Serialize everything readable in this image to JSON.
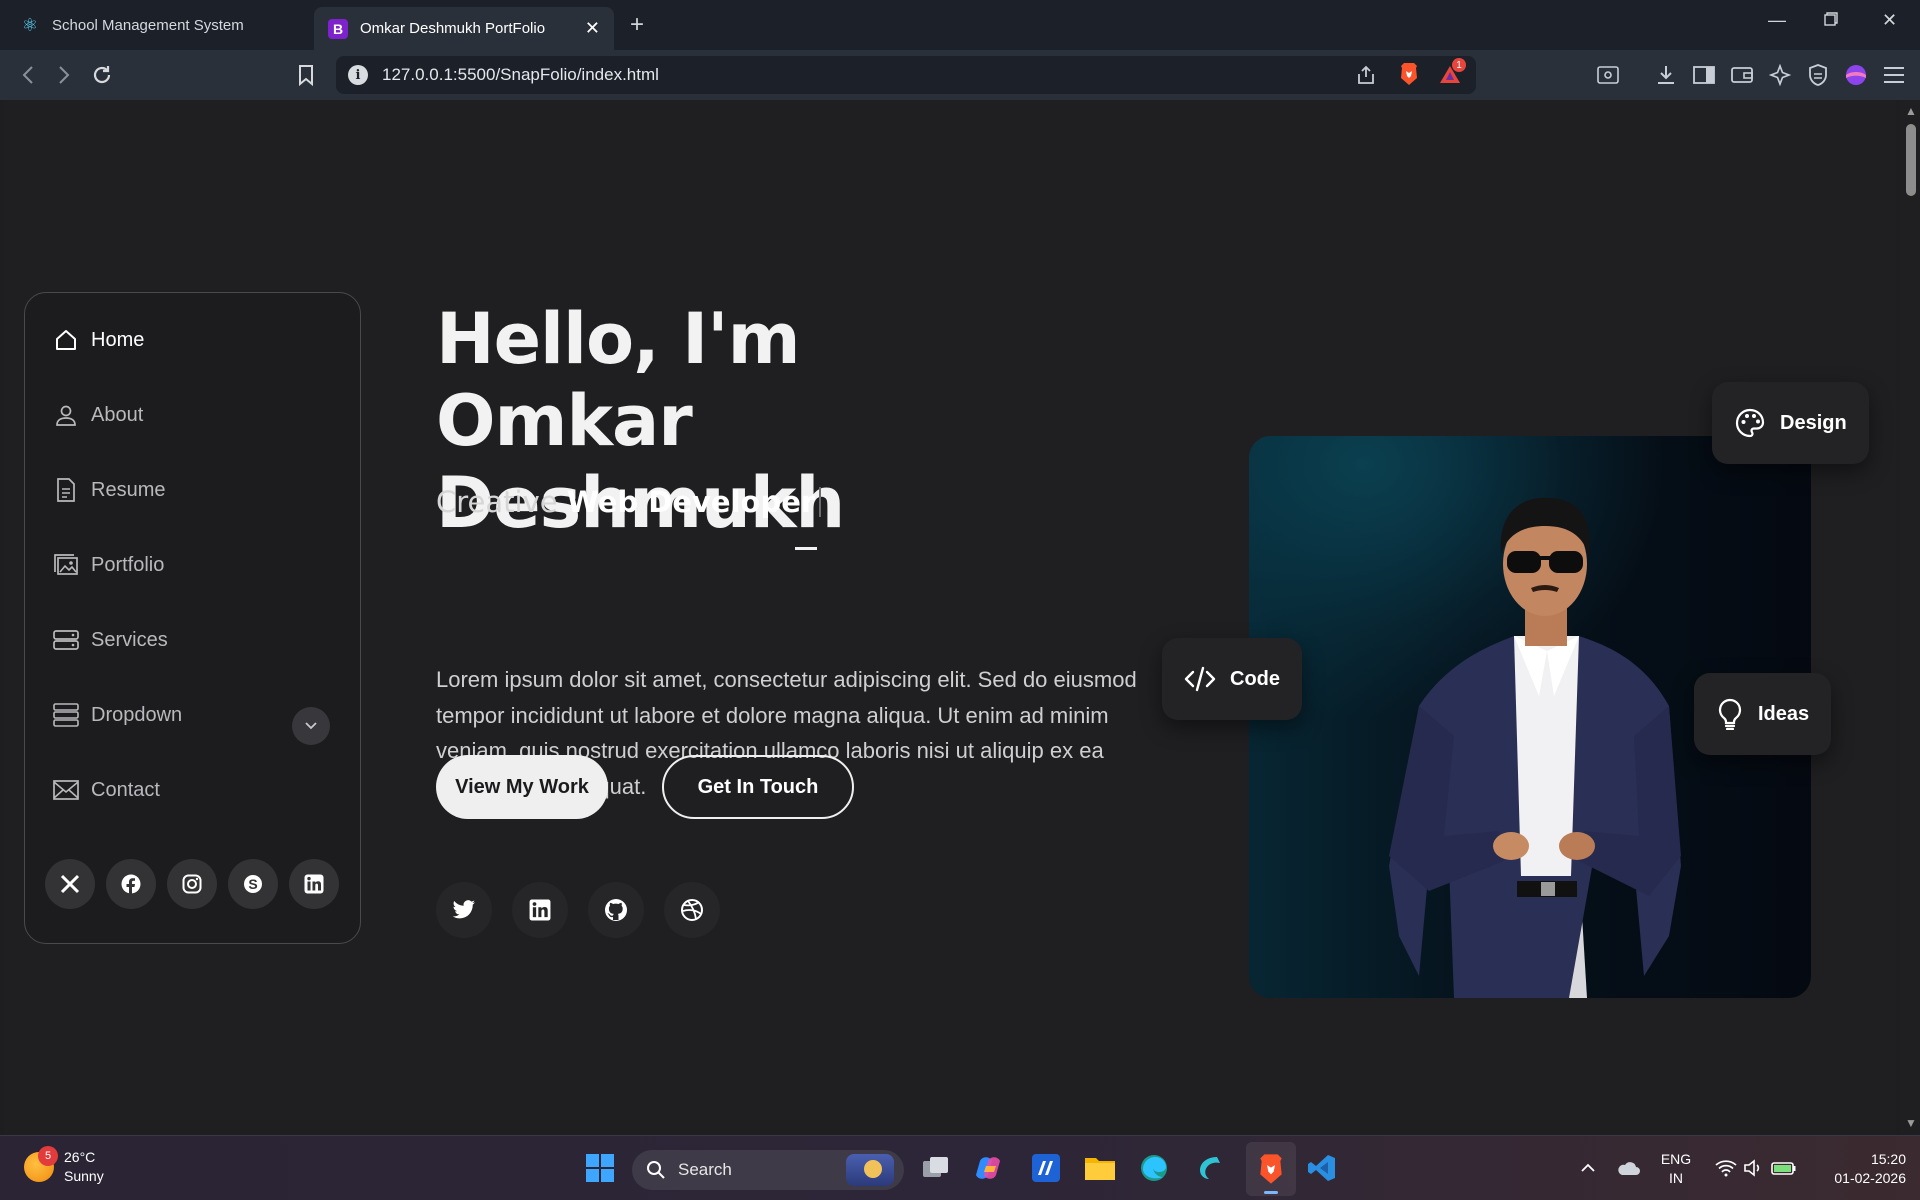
{
  "browser": {
    "tabs": [
      {
        "title": "School Management System",
        "active": false,
        "favicon": "react-icon"
      },
      {
        "title": "Omkar Deshmukh PortFolio",
        "active": true,
        "favicon": "bootstrap-icon"
      }
    ],
    "address": "127.0.0.1:5500/SnapFolio/index.html",
    "brave_badge_count": "1"
  },
  "sidebar": {
    "items": [
      {
        "label": "Home",
        "icon": "home-icon",
        "active": true
      },
      {
        "label": "About",
        "icon": "person-icon",
        "active": false
      },
      {
        "label": "Resume",
        "icon": "file-icon",
        "active": false
      },
      {
        "label": "Portfolio",
        "icon": "images-icon",
        "active": false
      },
      {
        "label": "Services",
        "icon": "hdd-stack-icon",
        "active": false
      },
      {
        "label": "Dropdown",
        "icon": "menu-icon",
        "active": false
      },
      {
        "label": "Contact",
        "icon": "envelope-icon",
        "active": false
      }
    ],
    "social": [
      "x-icon",
      "facebook-icon",
      "instagram-icon",
      "skype-icon",
      "linkedin-icon"
    ]
  },
  "hero": {
    "title_line1": "Hello, I'm Omkar",
    "title_line2": "Deshmuk",
    "title_caret_char": "h",
    "subtitle_prefix": "Creative",
    "subtitle_bold": "Web Developer",
    "description": "Lorem ipsum dolor sit amet, consectetur adipiscing elit. Sed do eiusmod tempor incididunt ut labore et dolore magna aliqua. Ut enim ad minim veniam, quis nostrud exercitation ullamco laboris nisi ut aliquip ex ea commodo consequat.",
    "primary_button": "View My Work",
    "secondary_button": "Get In Touch",
    "social": [
      "twitter-icon",
      "linkedin-icon",
      "github-icon",
      "dribbble-icon"
    ]
  },
  "badges": {
    "design": "Design",
    "code": "Code",
    "ideas": "Ideas"
  },
  "taskbar": {
    "weather_temp": "26°C",
    "weather_desc": "Sunny",
    "weather_badge": "5",
    "search_placeholder": "Search",
    "lang_line1": "ENG",
    "lang_line2": "IN",
    "time": "15:20",
    "date": "01-02-2026"
  }
}
